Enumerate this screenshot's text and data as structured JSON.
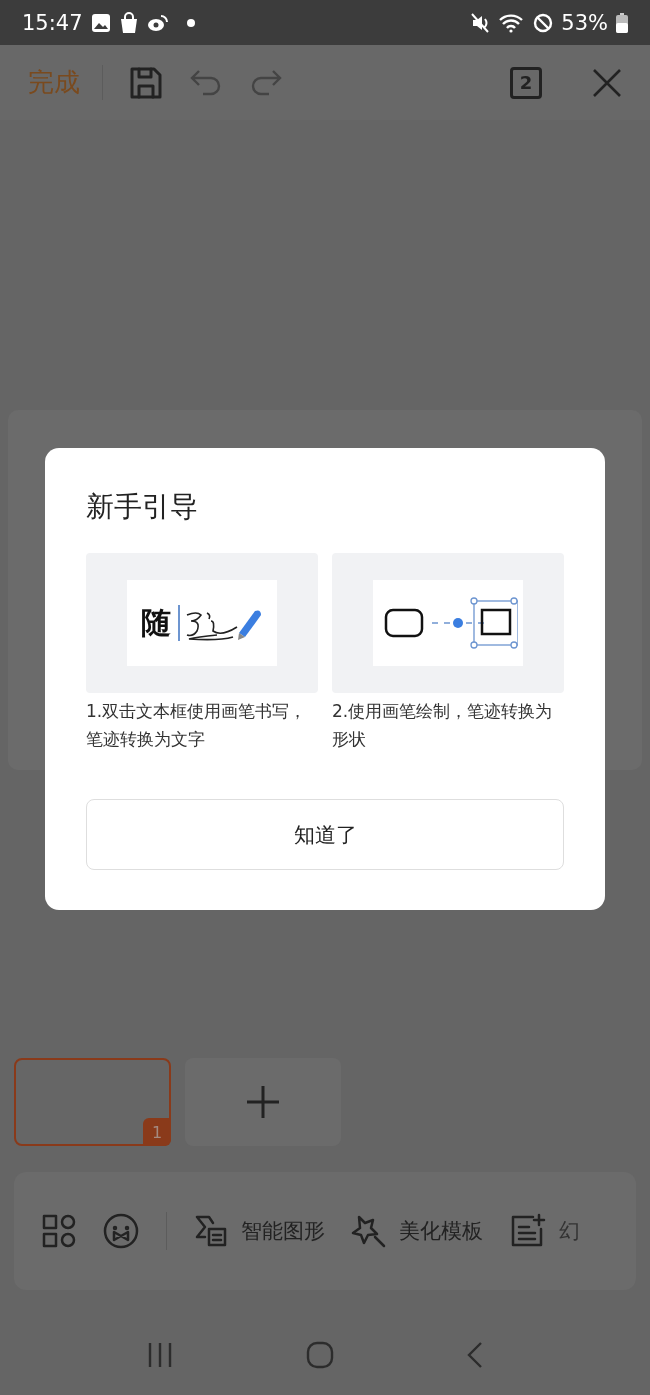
{
  "status_bar": {
    "time": "15:47",
    "battery": "53%"
  },
  "toolbar": {
    "done": "完成",
    "page_count": "2"
  },
  "dialog": {
    "title": "新手引导",
    "tips": [
      {
        "kind": "text",
        "sample": "随",
        "caption": "1.双击文本框使用画笔书写，笔迹转换为文字"
      },
      {
        "kind": "shape",
        "caption": "2.使用画笔绘制，笔迹转换为形状"
      }
    ],
    "button": "知道了"
  },
  "slides": [
    {
      "number": "1",
      "selected": true
    }
  ],
  "tools": [
    {
      "kind": "grid"
    },
    {
      "kind": "face"
    },
    {
      "kind": "smart",
      "label": "智能图形"
    },
    {
      "kind": "magic",
      "label": "美化模板"
    },
    {
      "kind": "add",
      "label": "幻"
    }
  ]
}
